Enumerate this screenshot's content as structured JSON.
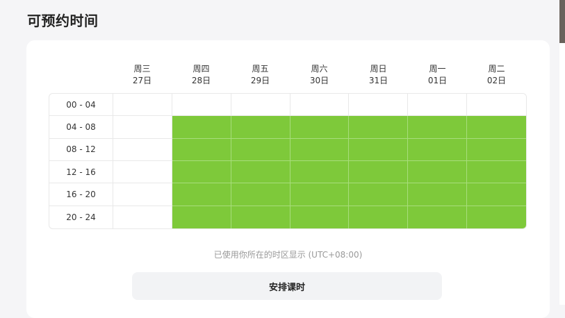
{
  "title": "可预约时间",
  "days": [
    {
      "weekday": "周三",
      "date": "27日"
    },
    {
      "weekday": "周四",
      "date": "28日"
    },
    {
      "weekday": "周五",
      "date": "29日"
    },
    {
      "weekday": "周六",
      "date": "30日"
    },
    {
      "weekday": "周日",
      "date": "31日"
    },
    {
      "weekday": "周一",
      "date": "01日"
    },
    {
      "weekday": "周二",
      "date": "02日"
    }
  ],
  "time_slots": [
    "00 - 04",
    "04 - 08",
    "08 - 12",
    "12 - 16",
    "16 - 20",
    "20 - 24"
  ],
  "availability": [
    [
      false,
      false,
      false,
      false,
      false,
      false,
      false
    ],
    [
      false,
      true,
      true,
      true,
      true,
      true,
      true
    ],
    [
      false,
      true,
      true,
      true,
      true,
      true,
      true
    ],
    [
      false,
      true,
      true,
      true,
      true,
      true,
      true
    ],
    [
      false,
      true,
      true,
      true,
      true,
      true,
      true
    ],
    [
      false,
      true,
      true,
      true,
      true,
      true,
      true
    ]
  ],
  "available_color": "#7ec93a",
  "timezone_note": "已使用你所在的时区显示 (UTC+08:00)",
  "arrange_button_label": "安排课时"
}
